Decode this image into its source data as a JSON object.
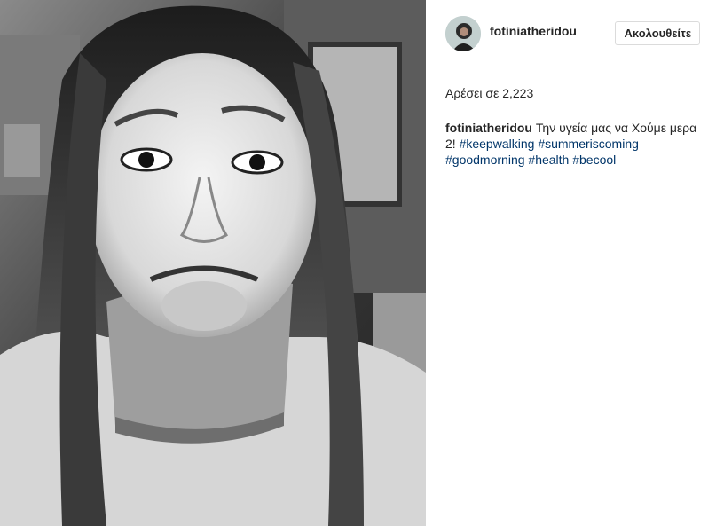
{
  "post": {
    "username": "fotiniatheridou",
    "follow_label": "Ακολουθείτε",
    "likes_text": "Αρέσει σε 2,223",
    "caption": {
      "username": "fotiniatheridou",
      "text": "Την υγεία μας να Χούμε μερα 2!",
      "hashtags": [
        "#keepwalking",
        "#summeriscoming",
        "#goodmorning",
        "#health",
        "#becool"
      ]
    }
  },
  "colors": {
    "text": "#262626",
    "hashtag": "#003569",
    "divider": "#efefef",
    "button_border": "#dbdbdb"
  },
  "icons": {
    "avatar": "profile-photo",
    "photo": "black-and-white-selfie-with-neck-brace"
  }
}
